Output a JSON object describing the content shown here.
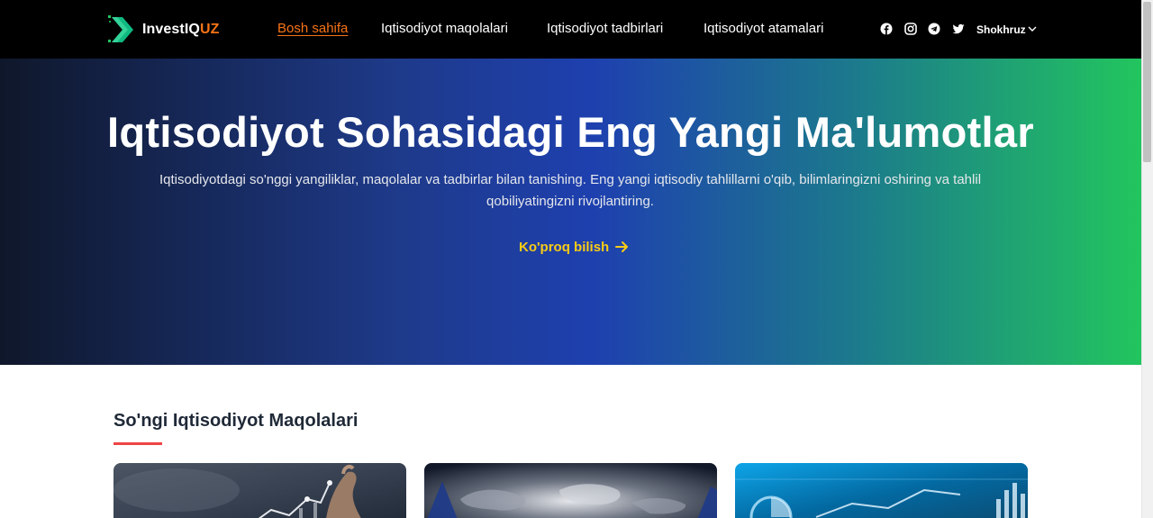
{
  "brand": {
    "name_main": "InvestIQ",
    "name_accent": "UZ",
    "accent_color": "#f97316"
  },
  "nav": {
    "links": [
      {
        "label": "Bosh sahifa",
        "active": true
      },
      {
        "label": "Iqtisodiyot maqolalari",
        "active": false
      },
      {
        "label": "Iqtisodiyot tadbirlari",
        "active": false
      },
      {
        "label": "Iqtisodiyot atamalari",
        "active": false
      }
    ],
    "social_icons": [
      "facebook-icon",
      "instagram-icon",
      "telegram-icon",
      "twitter-icon"
    ],
    "user": {
      "name": "Shokhruz",
      "icon": "chevron-down-icon"
    }
  },
  "hero": {
    "title": "Iqtisodiyot Sohasidagi Eng Yangi Ma'lumotlar",
    "subtitle": "Iqtisodiyotdagi so'nggi yangiliklar, maqolalar va tadbirlar bilan tanishing. Eng yangi iqtisodiy tahlillarni o'qib, bilimlaringizni oshiring va tahlil qobiliyatingizni rivojlantiring.",
    "cta_label": "Ko'proq bilish",
    "cta_icon": "arrow-right-icon",
    "cta_color": "#facc15"
  },
  "articles": {
    "section_title": "So'ngi Iqtisodiyot Maqolalari",
    "underline_color": "#ef4444",
    "cards": [
      {
        "image": "stock-chart-hand-image"
      },
      {
        "image": "world-map-handshake-image"
      },
      {
        "image": "digital-dashboard-image"
      }
    ]
  }
}
